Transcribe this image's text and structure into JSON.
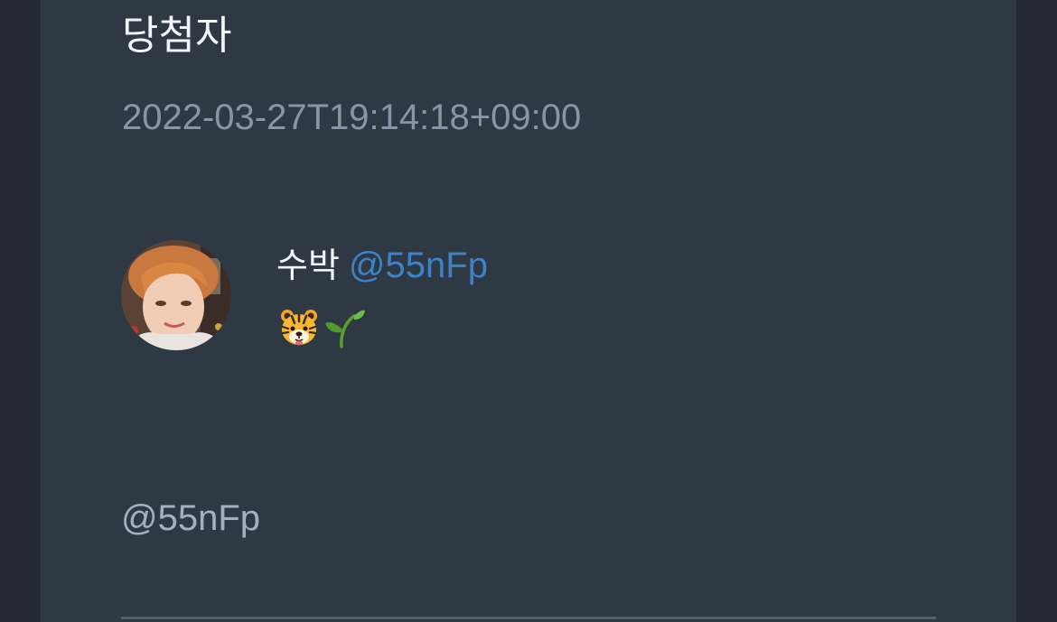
{
  "post": {
    "title": "당첨자",
    "timestamp": "2022-03-27T19:14:18+09:00"
  },
  "user": {
    "display_name": "수박",
    "handle": "@55nFp",
    "bio_icons": [
      "tiger-face-icon",
      "seedling-icon"
    ]
  },
  "mention": "@55nFp",
  "colors": {
    "page_background": "#232a33",
    "panel_background": "#2e3944",
    "primary_text": "#f2f5f8",
    "muted_text": "#8796a6",
    "link": "#3d82c9",
    "mention_text": "#a3b1bf",
    "divider": "#56616c"
  }
}
